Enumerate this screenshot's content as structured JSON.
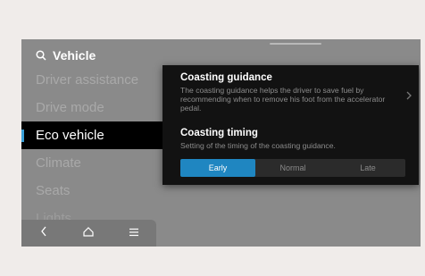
{
  "search": {
    "icon": "search-icon",
    "label": "Vehicle"
  },
  "menu": {
    "items": [
      {
        "label": "Driver assistance",
        "active": false
      },
      {
        "label": "Drive mode",
        "active": false
      },
      {
        "label": "Eco vehicle",
        "active": true
      },
      {
        "label": "Climate",
        "active": false
      },
      {
        "label": "Seats",
        "active": false
      },
      {
        "label": "Lights",
        "active": false
      }
    ],
    "accent": "#3aa0d8"
  },
  "popup": {
    "coasting_guidance": {
      "title": "Coasting guidance",
      "description": "The coasting guidance helps the driver to save fuel by recommending when to remove his foot from the accelerator pedal."
    },
    "coasting_timing": {
      "title": "Coasting timing",
      "description": "Setting of the timing of the coasting guidance.",
      "options": [
        "Early",
        "Normal",
        "Late"
      ],
      "selected": "Early",
      "accent": "#1f86c1"
    }
  },
  "bottom_bar": {
    "buttons": [
      "back-icon",
      "home-icon",
      "menu-icon"
    ]
  }
}
